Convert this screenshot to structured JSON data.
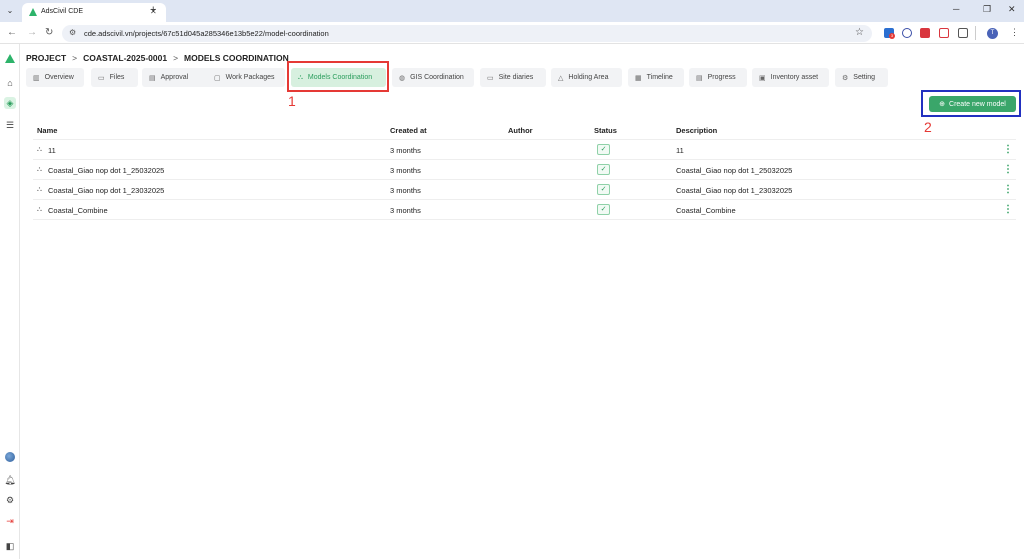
{
  "browser": {
    "tab_title": "AdsCivil CDE",
    "url": "cde.adscivil.vn/projects/67c51d045a285346e13b5e22/model-coordination",
    "avatar_letter": "T",
    "ext_badge": "3"
  },
  "breadcrumb": {
    "items": [
      "PROJECT",
      "COASTAL-2025-0001",
      "MODELS COORDINATION"
    ],
    "separator": ">"
  },
  "tabs": [
    {
      "label": "Overview",
      "icon": "bar-chart-icon"
    },
    {
      "label": "Files",
      "icon": "folder-icon"
    },
    {
      "label": "Approval",
      "icon": "document-icon"
    },
    {
      "label": "Work Packages",
      "icon": "package-icon"
    },
    {
      "label": "Models Coordination",
      "icon": "models-icon",
      "active": true
    },
    {
      "label": "GIS Coordination",
      "icon": "globe-icon"
    },
    {
      "label": "Site diaries",
      "icon": "book-icon"
    },
    {
      "label": "Holding Area",
      "icon": "warning-icon"
    },
    {
      "label": "Timeline",
      "icon": "calendar-icon"
    },
    {
      "label": "Progress",
      "icon": "gantt-icon"
    },
    {
      "label": "Inventory asset",
      "icon": "box-icon"
    },
    {
      "label": "Setting",
      "icon": "gear-icon"
    }
  ],
  "annotations": {
    "label_1": "1",
    "label_2": "2",
    "colors": {
      "red": "#e53935",
      "blue": "#2230c0"
    }
  },
  "create_button": {
    "label": "Create new model",
    "icon": "plus-circle-icon"
  },
  "table": {
    "columns": [
      "Name",
      "Created at",
      "Author",
      "Status",
      "Description"
    ],
    "rows": [
      {
        "name": "11",
        "created_at": "3 months",
        "author": "",
        "status": "ok",
        "description": "11"
      },
      {
        "name": "Coastal_Giao nop dot 1_25032025",
        "created_at": "3 months",
        "author": "",
        "status": "ok",
        "description": "Coastal_Giao nop dot 1_25032025"
      },
      {
        "name": "Coastal_Giao nop dot 1_23032025",
        "created_at": "3 months",
        "author": "",
        "status": "ok",
        "description": "Coastal_Giao nop dot 1_23032025"
      },
      {
        "name": "Coastal_Combine",
        "created_at": "3 months",
        "author": "",
        "status": "ok",
        "description": "Coastal_Combine"
      }
    ]
  },
  "theme": {
    "accent": "#3aa66a",
    "active_tab_bg": "#d7f0df"
  }
}
